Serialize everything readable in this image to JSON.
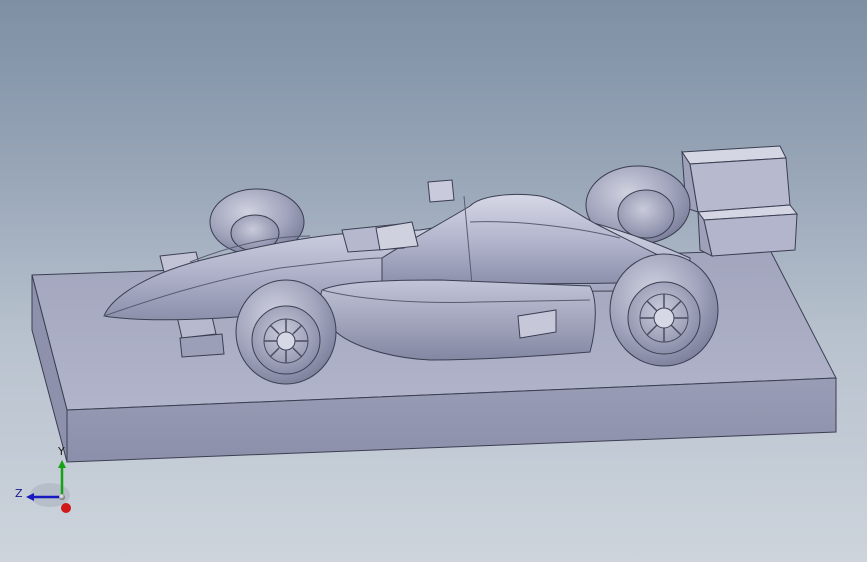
{
  "viewport": {
    "background_top": "#7e8fa4",
    "background_bottom": "#cdd4dc",
    "model_color": "#a9acc4"
  },
  "triad": {
    "z_label": "Z",
    "y_label": "Y",
    "x_axis_color": "#d01818",
    "y_axis_color": "#18a018",
    "z_axis_color": "#1818c0"
  }
}
